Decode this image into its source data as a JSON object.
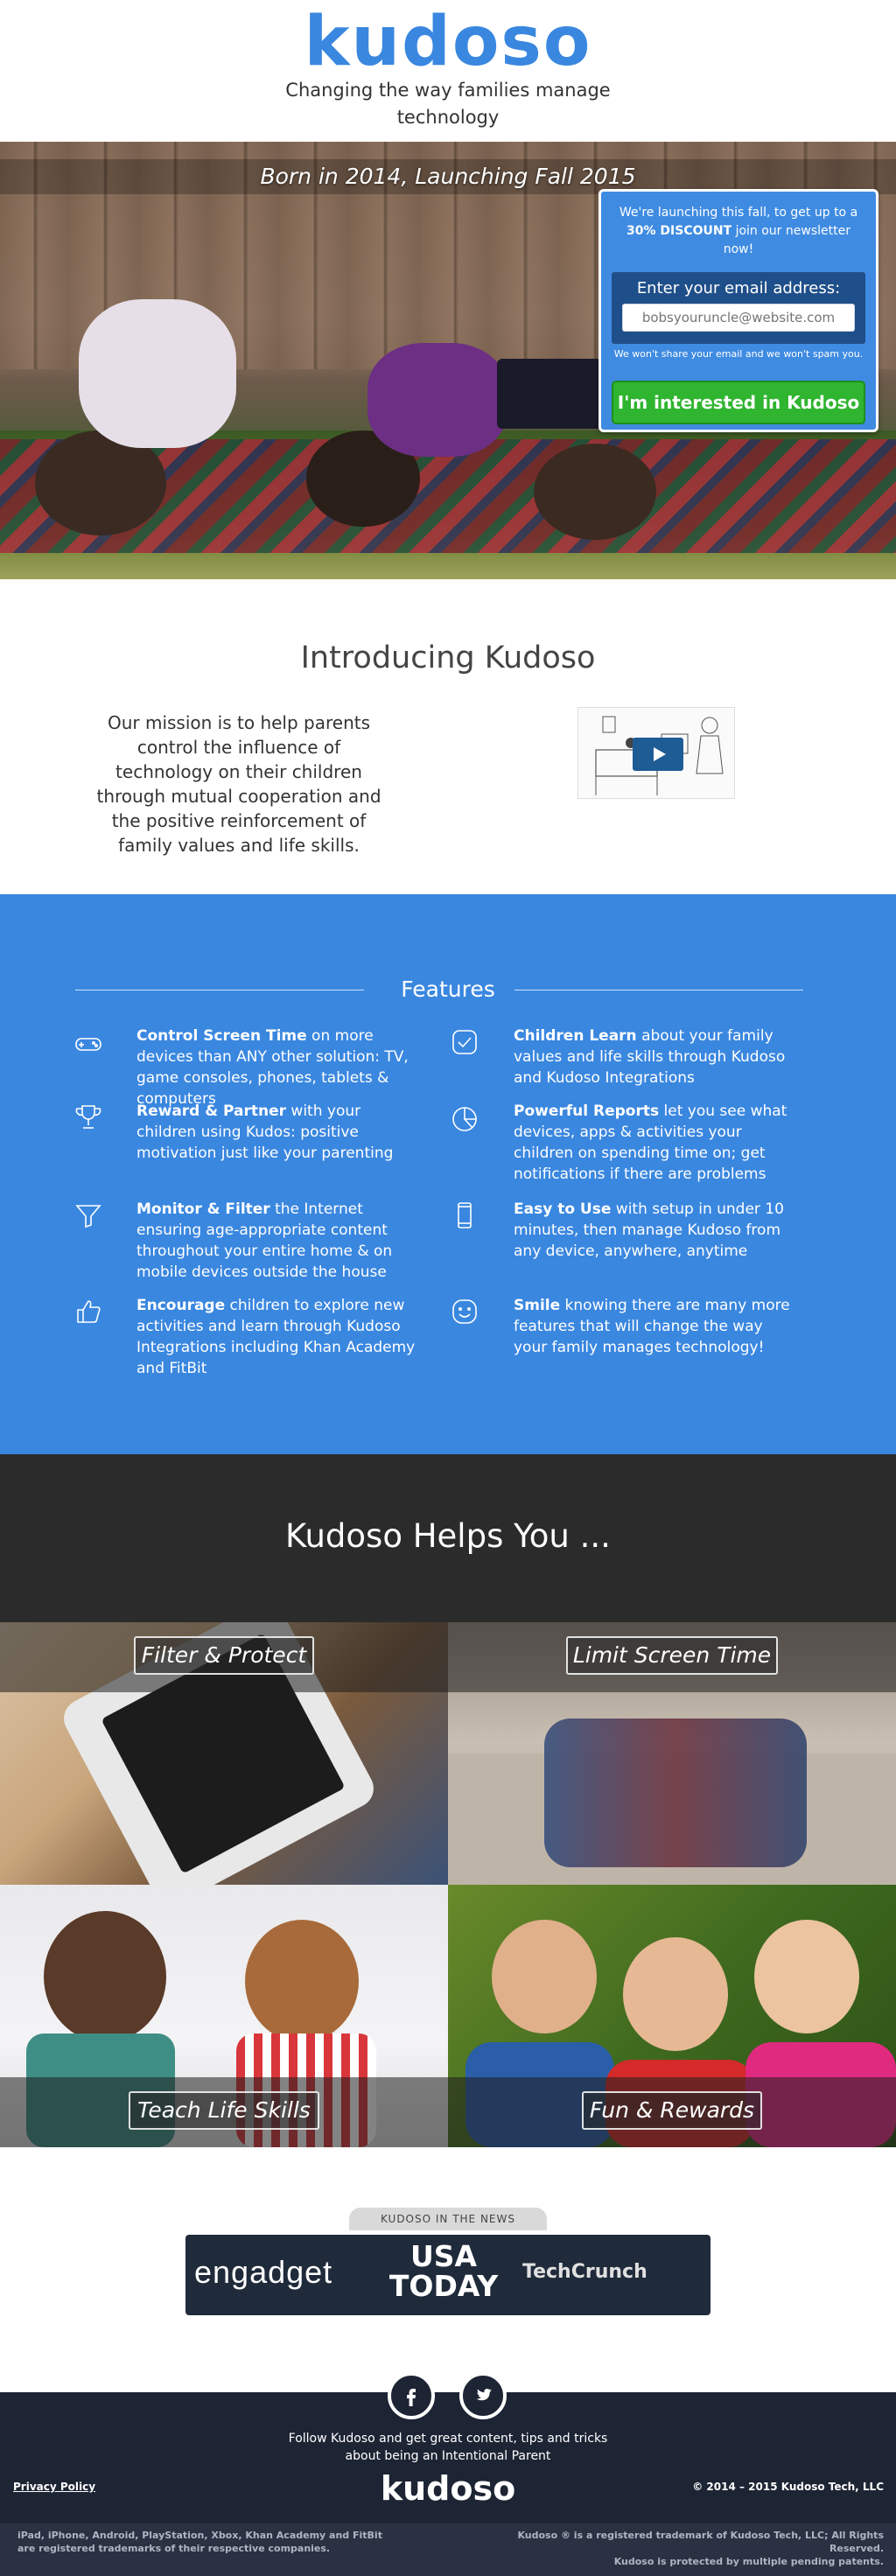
{
  "header": {
    "logo": "kudoso",
    "tagline": "Changing the way families manage technology"
  },
  "hero": {
    "title": "Born in 2014, Launching Fall 2015"
  },
  "signup": {
    "promo_pre": "We're launching this fall, to get up to a",
    "promo_bold": "30% DISCOUNT",
    "promo_post": "join our newsletter now!",
    "email_label": "Enter your email address:",
    "email_placeholder": "bobsyouruncle@website.com",
    "privacy": "We won't share your email and we won't spam you.",
    "cta": "I'm interested in Kudoso"
  },
  "intro": {
    "title": "Introducing Kudoso",
    "mission": "Our mission is to help parents control the influence of technology on their children through mutual cooperation and the positive reinforcement of family values and life skills."
  },
  "features": {
    "title": "Features",
    "items": [
      {
        "icon": "gamepad-icon",
        "bold": "Control Screen Time",
        "text": " on more devices than ANY other solution: TV, game consoles, phones, tablets & computers"
      },
      {
        "icon": "checkmark-icon",
        "bold": "Children Learn",
        "text": " about your family values and life skills through Kudoso and Kudoso Integrations"
      },
      {
        "icon": "trophy-icon",
        "bold": "Reward & Partner",
        "text": " with your children using Kudos: positive motivation just like your parenting"
      },
      {
        "icon": "pie-chart-icon",
        "bold": "Powerful Reports",
        "text": " let you see what devices, apps & activities your children on spending time on; get notifications if there are problems"
      },
      {
        "icon": "filter-icon",
        "bold": "Monitor & Filter",
        "text": " the Internet ensuring age-appropriate content throughout your entire home & on mobile devices outside the house"
      },
      {
        "icon": "phone-icon",
        "bold": "Easy to Use",
        "text": " with setup in under 10 minutes, then manage Kudoso from any device, anywhere, anytime"
      },
      {
        "icon": "thumbs-up-icon",
        "bold": "Encourage",
        "text": " children to explore new activities and learn through Kudoso Integrations including Khan Academy and FitBit"
      },
      {
        "icon": "smile-icon",
        "bold": "Smile",
        "text": " knowing there are many more features that will change the way your family manages technology!"
      }
    ]
  },
  "helps": {
    "title": "Kudoso Helps You ...",
    "tiles": [
      {
        "label": "Filter & Protect"
      },
      {
        "label": "Limit Screen Time"
      },
      {
        "label": "Teach Life Skills"
      },
      {
        "label": "Fun & Rewards"
      }
    ]
  },
  "news": {
    "tab": "KUDOSO IN THE NEWS",
    "logos": [
      "engadget",
      "USA TODAY",
      "TechCrunch"
    ]
  },
  "footer": {
    "follow": "Follow Kudoso and get great content, tips and tricks about being an Intentional Parent",
    "privacy": "Privacy Policy",
    "copyright": "© 2014 – 2015 Kudoso Tech, LLC",
    "logo": "kudoso",
    "legal_left": "iPad, iPhone, Android, PlayStation, Xbox, Khan Academy and FitBit are registered trademarks of their respective companies.",
    "legal_right_1": "Kudoso ® is a registered trademark of Kudoso Tech, LLC; All Rights Reserved.",
    "legal_right_2": "Kudoso is protected by multiple pending patents."
  },
  "colors": {
    "brand_blue": "#3a87e0",
    "cta_green": "#2fb52f",
    "dark": "#2b2b2b",
    "footer": "#1d2434"
  }
}
